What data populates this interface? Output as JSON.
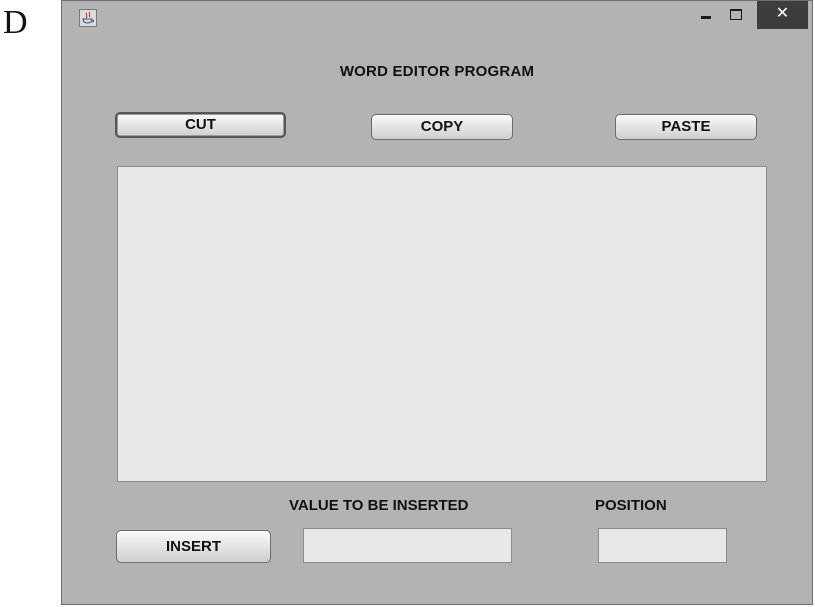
{
  "page": {
    "letter": "D"
  },
  "window": {
    "controls": {
      "minimize_icon": "minimize-icon",
      "maximize_icon": "maximize-icon",
      "close_icon": "close-icon",
      "close_glyph": "✕"
    },
    "app_icon": "java-icon",
    "accent": "#3d3d3d"
  },
  "app": {
    "title": "WORD EDITOR PROGRAM",
    "toolbar": {
      "cut_label": "CUT",
      "copy_label": "COPY",
      "paste_label": "PASTE"
    },
    "editor": {
      "text": ""
    },
    "insert": {
      "button_label": "INSERT",
      "value_label": "VALUE TO BE INSERTED",
      "value_text": "",
      "position_label": "POSITION",
      "position_text": ""
    }
  }
}
